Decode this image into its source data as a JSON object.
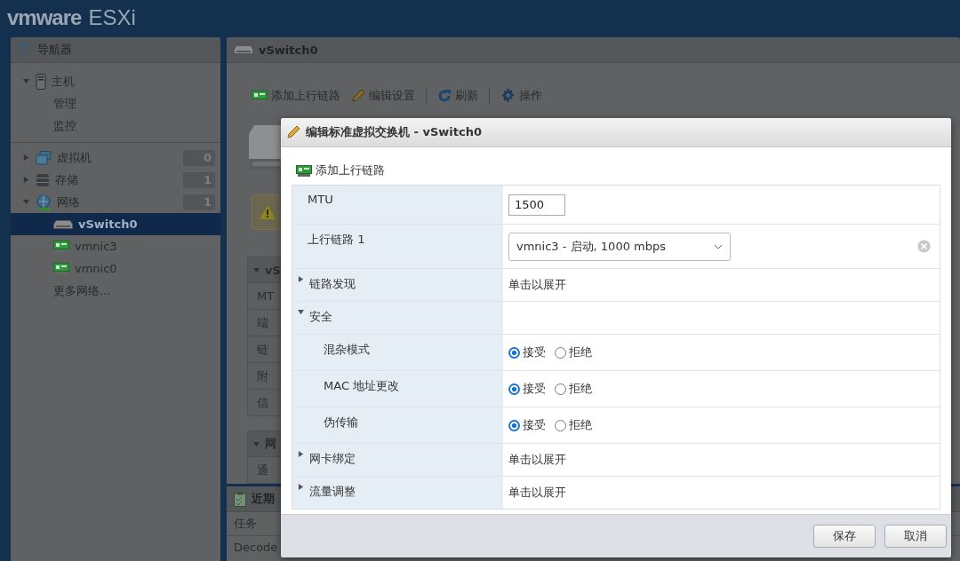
{
  "header": {
    "brand": "vmware",
    "product": "ESXi"
  },
  "navigator": {
    "title": "导航器",
    "tree": [
      {
        "kind": "host",
        "label": "主机",
        "expanded": true,
        "selected": false,
        "children": [
          {
            "kind": "link",
            "label": "管理",
            "selected": false
          },
          {
            "kind": "link",
            "label": "监控",
            "selected": false
          }
        ]
      },
      {
        "kind": "vm",
        "label": "虚拟机",
        "count": "0",
        "expanded": false,
        "selected": false
      },
      {
        "kind": "storage",
        "label": "存储",
        "count": "1",
        "expanded": false,
        "selected": false
      },
      {
        "kind": "network",
        "label": "网络",
        "count": "1",
        "expanded": true,
        "selected": false,
        "children": [
          {
            "kind": "switch",
            "label": "vSwitch0",
            "selected": true
          },
          {
            "kind": "nic",
            "label": "vmnic3",
            "selected": false
          },
          {
            "kind": "nic",
            "label": "vmnic0",
            "selected": false
          },
          {
            "kind": "link",
            "label": "更多网络...",
            "selected": false
          }
        ]
      }
    ]
  },
  "main": {
    "title": "vSwitch0",
    "toolbar": [
      {
        "kind": "add-uplink",
        "label": "添加上行链路"
      },
      {
        "kind": "edit",
        "label": "编辑设置"
      },
      {
        "kind": "separator"
      },
      {
        "kind": "refresh",
        "label": "刷新"
      },
      {
        "kind": "separator"
      },
      {
        "kind": "actions",
        "label": "操作"
      }
    ],
    "sections": [
      {
        "title": "vS",
        "expanded": true,
        "rows": [
          "MT",
          "端",
          "链",
          "附",
          "信"
        ]
      },
      {
        "title": "网",
        "expanded": true,
        "rows": [
          "通"
        ]
      }
    ]
  },
  "recent_tasks": {
    "title": "近期",
    "columns": [
      "任务"
    ],
    "rows": [
      "Decode"
    ]
  },
  "dialog": {
    "title": "编辑标准虚拟交换机 - vSwitch0",
    "add_uplink": "添加上行链路",
    "rows": [
      {
        "kind": "input",
        "label": "MTU",
        "value": "1500"
      },
      {
        "kind": "select",
        "label": "上行链路 1",
        "value": "vmnic3 - 启动, 1000 mbps",
        "clearable": true
      },
      {
        "kind": "group",
        "label": "链路发现",
        "expanded": false,
        "value": "单击以展开"
      },
      {
        "kind": "group",
        "label": "安全",
        "expanded": true,
        "children": [
          {
            "kind": "radio",
            "label": "混杂模式",
            "options": [
              {
                "label": "接受",
                "selected": true
              },
              {
                "label": "拒绝",
                "selected": false
              }
            ]
          },
          {
            "kind": "radio",
            "label": "MAC 地址更改",
            "options": [
              {
                "label": "接受",
                "selected": true
              },
              {
                "label": "拒绝",
                "selected": false
              }
            ]
          },
          {
            "kind": "radio",
            "label": "伪传输",
            "options": [
              {
                "label": "接受",
                "selected": true
              },
              {
                "label": "拒绝",
                "selected": false
              }
            ]
          }
        ]
      },
      {
        "kind": "group",
        "label": "网卡绑定",
        "expanded": false,
        "value": "单击以展开"
      },
      {
        "kind": "group",
        "label": "流量调整",
        "expanded": false,
        "value": "单击以展开"
      }
    ],
    "buttons": [
      "保存",
      "取消"
    ]
  }
}
